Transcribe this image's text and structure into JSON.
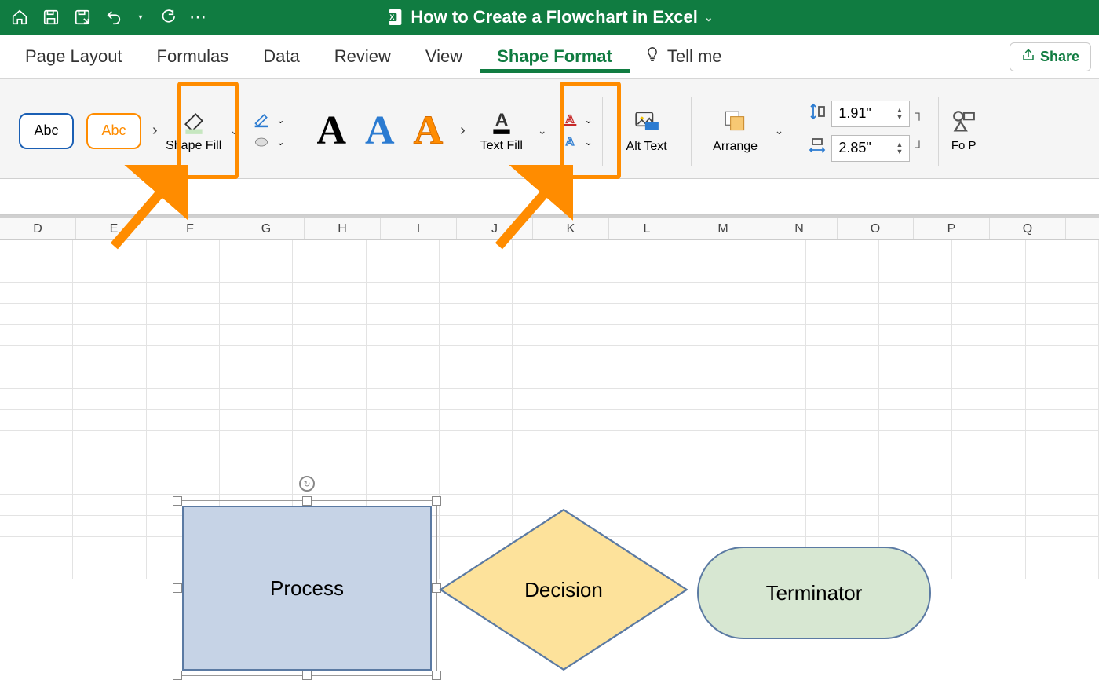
{
  "title": "How to Create a Flowchart in Excel",
  "qat": {
    "more": "⋯"
  },
  "tabs": [
    "Page Layout",
    "Formulas",
    "Data",
    "Review",
    "View",
    "Shape Format"
  ],
  "active_tab_index": 5,
  "tellme": "Tell me",
  "share": "Share",
  "ribbon": {
    "style_label": "Abc",
    "shapefill": "Shape Fill",
    "textfill": "Text Fill",
    "alttext": "Alt Text",
    "arrange": "Arrange",
    "formatpane_edge": "Fo P",
    "height": "1.91\"",
    "width": "2.85\""
  },
  "columns": [
    "D",
    "E",
    "F",
    "G",
    "H",
    "I",
    "J",
    "K",
    "L",
    "M",
    "N",
    "O",
    "P",
    "Q"
  ],
  "row_count": 16,
  "shapes": {
    "process": "Process",
    "decision": "Decision",
    "terminator": "Terminator"
  }
}
